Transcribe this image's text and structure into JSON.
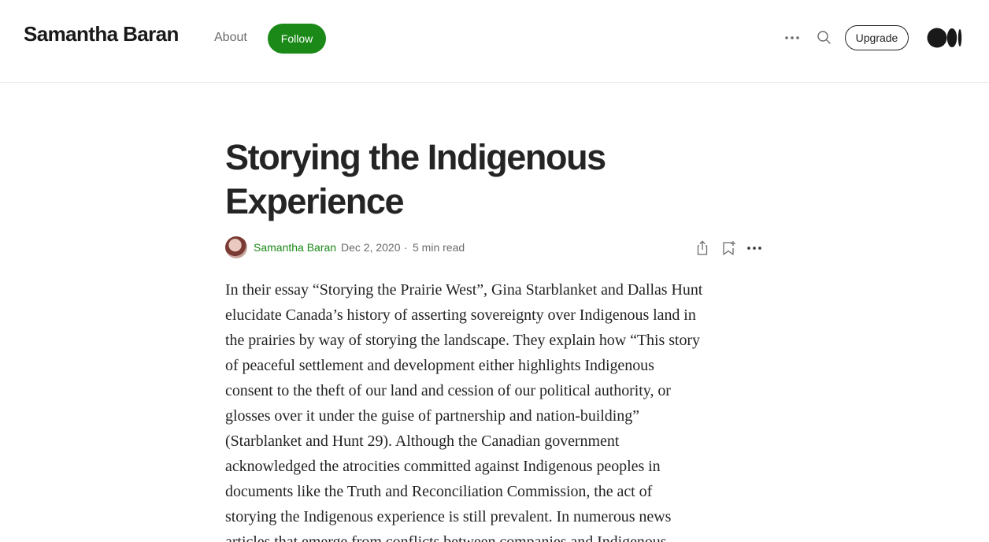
{
  "header": {
    "brand": "Samantha Baran",
    "about_label": "About",
    "follow_label": "Follow",
    "upgrade_label": "Upgrade",
    "more_icon": "more-horizontal-icon",
    "search_icon": "search-icon",
    "logo_icon": "medium-logo-icon",
    "accent_color": "#1a8917"
  },
  "article": {
    "title_lines": [
      "Storying the Indigenous",
      "Experience"
    ],
    "author": "Samantha Baran",
    "date": "Dec 2, 2020",
    "separator": "·",
    "read_time": "5 min read",
    "body_lines": [
      "In their essay “Storying the Prairie West”, Gina Starblanket and Dallas Hunt",
      "elucidate Canada’s history of asserting sovereignty over Indigenous land in",
      "the prairies by way of storying the landscape. They explain how “This story",
      "of peaceful settlement and development either highlights Indigenous",
      "consent to the theft of our land and cession of our political authority, or",
      "glosses over it under the guise of partnership and nation-building”",
      "(Starblanket and Hunt 29). Although the Canadian government",
      "acknowledged the atrocities committed against Indigenous peoples in",
      "documents like the Truth and Reconciliation Commission, the act of",
      "storying the Indigenous experience is still prevalent. In numerous news",
      "articles that emerge from conflicts between companies and Indigenous"
    ]
  }
}
